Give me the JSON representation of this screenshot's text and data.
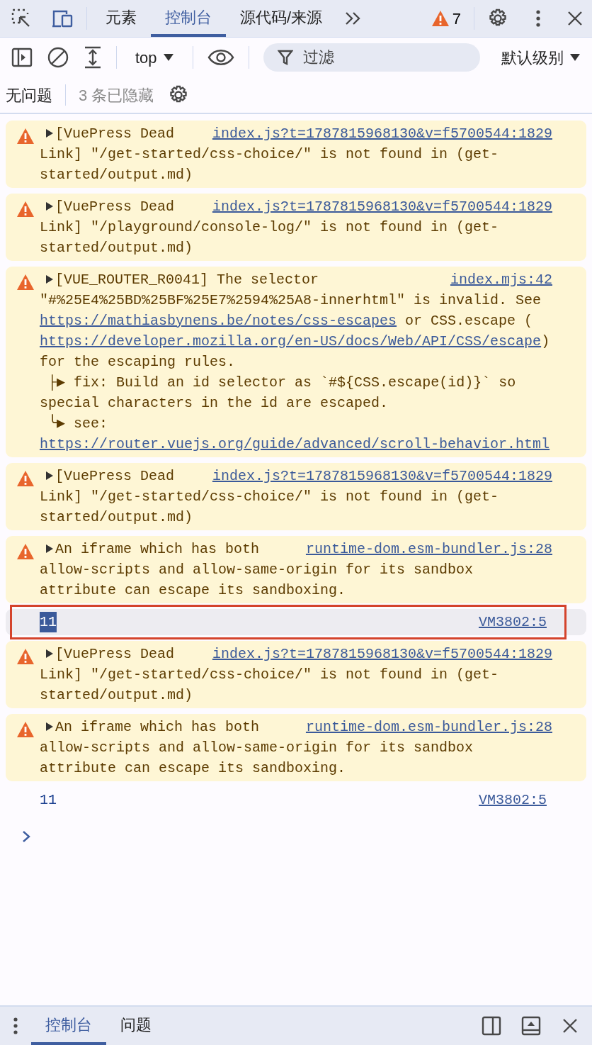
{
  "top_tabs": [
    {
      "label": "元素",
      "selected": false
    },
    {
      "label": "控制台",
      "selected": true
    },
    {
      "label": "源代码/来源",
      "selected": false
    }
  ],
  "warning_count": "7",
  "console_toolbar": {
    "context": "top",
    "filter_placeholder": "过滤",
    "level": "默认级别"
  },
  "issues_bar": {
    "issues": "无问题",
    "hidden": "3 条已隐藏"
  },
  "messages": [
    {
      "kind": "warning",
      "expanded": false,
      "source": "index.js?t=1787815968130&v=f5700544:1829",
      "lines": [
        [
          {
            "kind": "text",
            "text": "[VuePress Dead"
          }
        ],
        [
          {
            "kind": "text",
            "text": "Link] \"/get-started/css-choice/\" is not found in (get-"
          }
        ],
        [
          {
            "kind": "text",
            "text": "started/output.md)"
          }
        ]
      ]
    },
    {
      "kind": "warning",
      "expanded": false,
      "source": "index.js?t=1787815968130&v=f5700544:1829",
      "lines": [
        [
          {
            "kind": "text",
            "text": "[VuePress Dead"
          }
        ],
        [
          {
            "kind": "text",
            "text": "Link] \"/playground/console-log/\" is not found in (get-"
          }
        ],
        [
          {
            "kind": "text",
            "text": "started/output.md)"
          }
        ]
      ]
    },
    {
      "kind": "warning",
      "expanded": false,
      "source": "index.mjs:42",
      "lines": [
        [
          {
            "kind": "text",
            "text": "[VUE_ROUTER_R0041] The selector"
          }
        ],
        [
          {
            "kind": "text",
            "text": "\"#%25E4%25BD%25BF%25E7%2594%25A8-innerhtml\" is invalid. See"
          }
        ],
        [
          {
            "kind": "link",
            "text": "https://mathiasbynens.be/notes/css-escapes"
          },
          {
            "kind": "text",
            "text": " or CSS.escape ("
          }
        ],
        [
          {
            "kind": "link",
            "text": "https://developer.mozilla.org/en-US/docs/Web/API/CSS/escape"
          },
          {
            "kind": "text",
            "text": ")"
          }
        ],
        [
          {
            "kind": "text",
            "text": "for the escaping rules."
          }
        ],
        [
          {
            "kind": "text",
            "text": " ├▶ fix: Build an id selector as `#${CSS.escape(id)}` so"
          }
        ],
        [
          {
            "kind": "text",
            "text": "special characters in the id are escaped."
          }
        ],
        [
          {
            "kind": "text",
            "text": " ╰▶ see:"
          }
        ],
        [
          {
            "kind": "link",
            "text": "https://router.vuejs.org/guide/advanced/scroll-behavior.html"
          }
        ]
      ]
    },
    {
      "kind": "warning",
      "expanded": false,
      "source": "index.js?t=1787815968130&v=f5700544:1829",
      "lines": [
        [
          {
            "kind": "text",
            "text": "[VuePress Dead"
          }
        ],
        [
          {
            "kind": "text",
            "text": "Link] \"/get-started/css-choice/\" is not found in (get-"
          }
        ],
        [
          {
            "kind": "text",
            "text": "started/output.md)"
          }
        ]
      ]
    },
    {
      "kind": "warning",
      "expanded": false,
      "source": "runtime-dom.esm-bundler.js:28",
      "lines": [
        [
          {
            "kind": "text",
            "text": "An iframe which has both"
          }
        ],
        [
          {
            "kind": "text",
            "text": "allow-scripts and allow-same-origin for its sandbox"
          }
        ],
        [
          {
            "kind": "text",
            "text": "attribute can escape its sandboxing."
          }
        ]
      ]
    },
    {
      "kind": "log",
      "text": "11",
      "source": "VM3802:5",
      "text_selected": true,
      "outlined": true
    },
    {
      "kind": "warning",
      "expanded": false,
      "source": "index.js?t=1787815968130&v=f5700544:1829",
      "lines": [
        [
          {
            "kind": "text",
            "text": "[VuePress Dead"
          }
        ],
        [
          {
            "kind": "text",
            "text": "Link] \"/get-started/css-choice/\" is not found in (get-"
          }
        ],
        [
          {
            "kind": "text",
            "text": "started/output.md)"
          }
        ]
      ]
    },
    {
      "kind": "warning",
      "expanded": false,
      "source": "runtime-dom.esm-bundler.js:28",
      "lines": [
        [
          {
            "kind": "text",
            "text": "An iframe which has both"
          }
        ],
        [
          {
            "kind": "text",
            "text": "allow-scripts and allow-same-origin for its sandbox"
          }
        ],
        [
          {
            "kind": "text",
            "text": "attribute can escape its sandboxing."
          }
        ]
      ]
    },
    {
      "kind": "log",
      "text": "11",
      "source": "VM3802:5",
      "text_selected": false,
      "outlined": false
    }
  ],
  "drawer_tabs": [
    {
      "label": "控制台",
      "selected": true
    },
    {
      "label": "问题",
      "selected": false
    }
  ]
}
